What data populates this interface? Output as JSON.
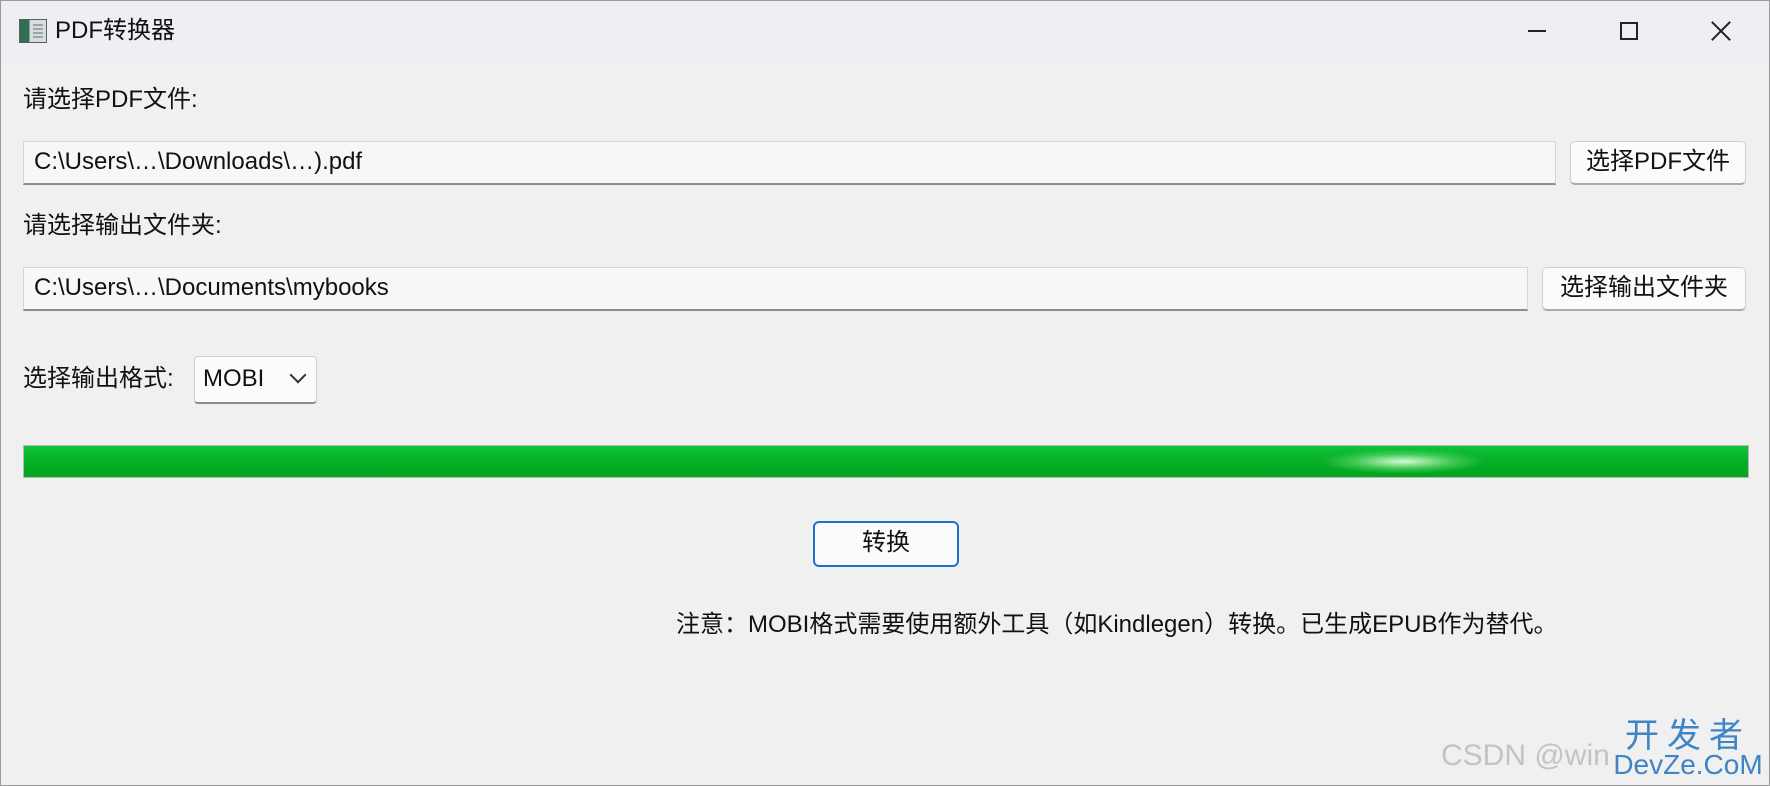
{
  "window": {
    "title": "PDF转换器",
    "controls": {
      "minimize_icon": "minimize-icon",
      "maximize_icon": "maximize-icon",
      "close_icon": "close-icon"
    }
  },
  "pdf_section": {
    "label": "请选择PDF文件:",
    "path_value": "C:\\Users\\…\\Downloads\\…).pdf",
    "button_label": "选择PDF文件"
  },
  "output_section": {
    "label": "请选择输出文件夹:",
    "path_value": "C:\\Users\\…\\Documents\\mybooks",
    "button_label": "选择输出文件夹"
  },
  "format_section": {
    "label": "选择输出格式:",
    "selected": "MOBI"
  },
  "progress": {
    "percent": 100,
    "fill_color": "#06b025"
  },
  "actions": {
    "convert_label": "转换"
  },
  "status": {
    "note": "注意：MOBI格式需要使用额外工具（如Kindlegen）转换。已生成EPUB作为替代。"
  },
  "watermarks": {
    "csdn": "CSDN @win",
    "site_line1": "开发者",
    "site_line2": "DevZe.CoM"
  },
  "colors": {
    "window_bg": "#f0f0f0",
    "progress_green": "#06b025",
    "primary_border": "#1f6fd1"
  }
}
